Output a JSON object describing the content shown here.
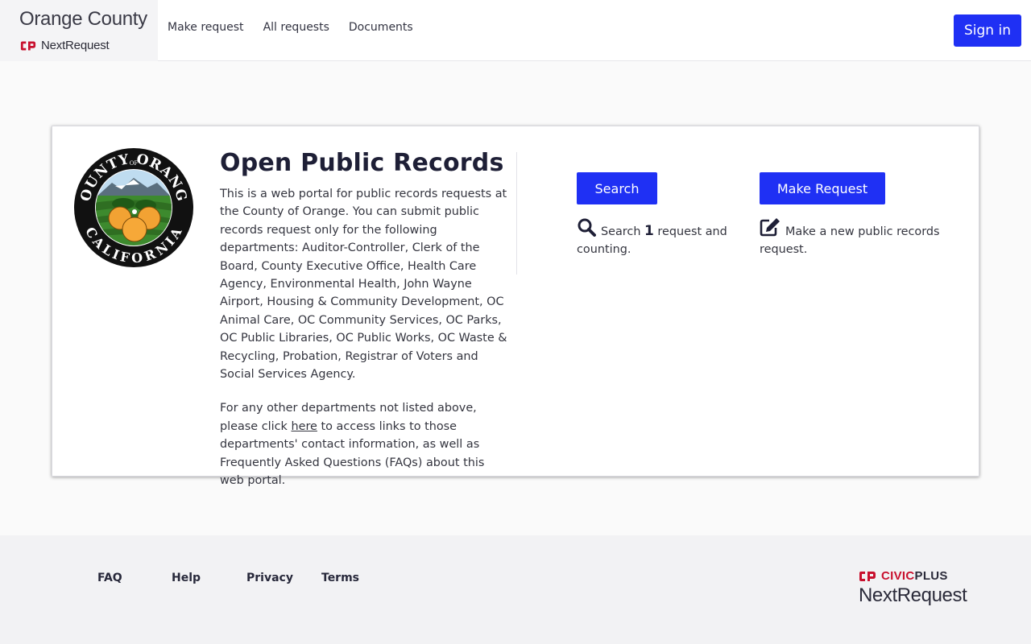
{
  "header": {
    "brand_title": "Orange County",
    "brand_product": "NextRequest",
    "nav": [
      {
        "label": "Make request"
      },
      {
        "label": "All requests"
      },
      {
        "label": "Documents"
      }
    ],
    "signin_label": "Sign in"
  },
  "main": {
    "seal_text": {
      "top": "COUNTY OF ORANGE",
      "of": "OF",
      "bottom": "CALIFORNIA"
    },
    "title": "Open Public Records",
    "intro_paragraph_1": "This is a web portal for public records requests at the County of Orange. You can submit public records request only for the following departments: Auditor-Controller, Clerk of the Board, County Executive Office, Health Care Agency, Environmental Health, John Wayne Airport, Housing & Community Development, OC Animal Care, OC Community Services, OC Parks, OC Public Libraries, OC Public Works, OC Waste & Recycling, Probation, Registrar of Voters and Social Services Agency.",
    "intro_paragraph_2_before": "For any other departments not listed above, please click ",
    "intro_paragraph_2_link": "here",
    "intro_paragraph_2_after": " to access links to those departments' contact information, as well as Frequently Asked Questions (FAQs) about this web portal.",
    "search": {
      "button_label": "Search",
      "desc_before": "Search ",
      "count": "1",
      "desc_after": " request and counting.",
      "icon": "search-icon"
    },
    "make_request": {
      "button_label": "Make Request",
      "desc": "Make a new public records request.",
      "icon": "edit-icon"
    }
  },
  "footer": {
    "links": [
      {
        "label": "FAQ"
      },
      {
        "label": "Help"
      },
      {
        "label": "Privacy"
      },
      {
        "label": "Terms"
      }
    ],
    "logo_top_red": "CIVIC",
    "logo_top_dark": "PLUS",
    "logo_bottom": "NextRequest"
  },
  "colors": {
    "primary_button": "#1f30f4",
    "civicplus_red": "#c8102e",
    "heading": "#1e1f36"
  }
}
